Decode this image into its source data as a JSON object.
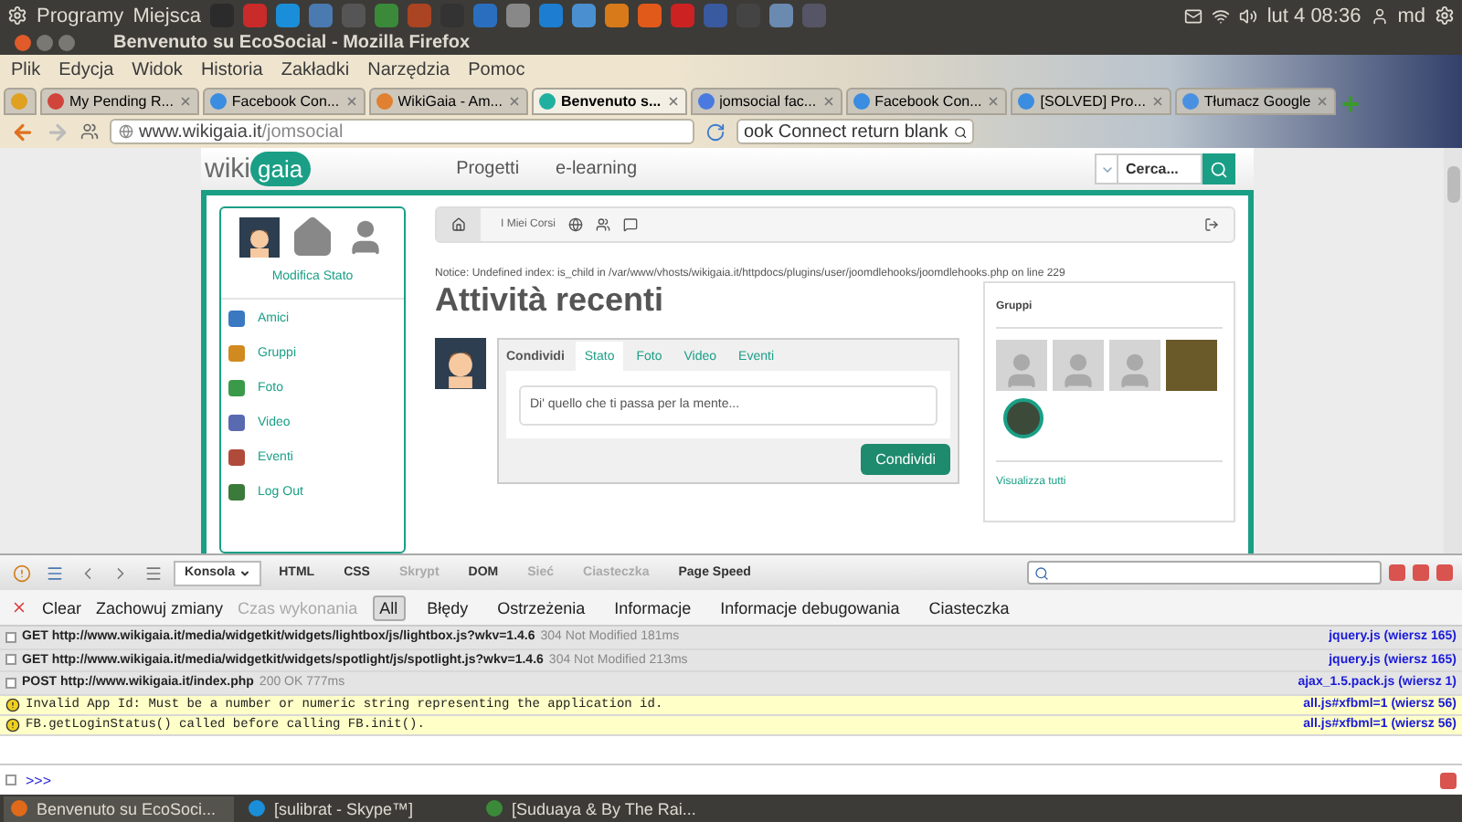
{
  "top_panel": {
    "menus": [
      "Programy",
      "Miejsca"
    ],
    "clock": "lut  4 08:36",
    "user": "md"
  },
  "window": {
    "title": "Benvenuto su EcoSocial - Mozilla Firefox"
  },
  "menu_bar": [
    "Plik",
    "Edycja",
    "Widok",
    "Historia",
    "Zakładki",
    "Narzędzia",
    "Pomoc"
  ],
  "tabs": [
    {
      "label": "My Pending R...",
      "selected": false
    },
    {
      "label": "Facebook Con...",
      "selected": false
    },
    {
      "label": "WikiGaia - Am...",
      "selected": false
    },
    {
      "label": "Benvenuto s...",
      "selected": true
    },
    {
      "label": "jomsocial fac...",
      "selected": false
    },
    {
      "label": "Facebook Con...",
      "selected": false
    },
    {
      "label": "[SOLVED] Pro...",
      "selected": false
    },
    {
      "label": "Tłumacz Google",
      "selected": false
    }
  ],
  "nav": {
    "url_domain": "www.wikigaia.it",
    "url_path": "/jomsocial",
    "search": "ook Connect return blank"
  },
  "site": {
    "logo_left": "wiki",
    "logo_right": "gaia",
    "links": [
      "Progetti",
      "e-learning"
    ],
    "search_placeholder": "Cerca..."
  },
  "sidebar": {
    "status_link": "Modifica Stato",
    "items": [
      "Amici",
      "Gruppi",
      "Foto",
      "Video",
      "Eventi",
      "Log Out"
    ]
  },
  "toolbar": {
    "label": "I Miei Corsi"
  },
  "notice": "Notice: Undefined index: is_child in /var/www/vhosts/wikigaia.it/httpdocs/plugins/user/joomdlehooks/joomdlehooks.php on line 229",
  "heading": "Attività recenti",
  "composer": {
    "label": "Condividi",
    "tabs": [
      {
        "label": "Stato",
        "selected": true
      },
      {
        "label": "Foto",
        "selected": false
      },
      {
        "label": "Video",
        "selected": false
      },
      {
        "label": "Eventi",
        "selected": false
      }
    ],
    "placeholder": "Di' quello che ti passa per la mente...",
    "button": "Condividi"
  },
  "groups": {
    "title": "Gruppi",
    "link": "Visualizza tutti"
  },
  "firebug": {
    "panels": [
      {
        "label": "Konsola",
        "selected": true,
        "disabled": false
      },
      {
        "label": "HTML",
        "selected": false,
        "disabled": false
      },
      {
        "label": "CSS",
        "selected": false,
        "disabled": false
      },
      {
        "label": "Skrypt",
        "selected": false,
        "disabled": true
      },
      {
        "label": "DOM",
        "selected": false,
        "disabled": false
      },
      {
        "label": "Sieć",
        "selected": false,
        "disabled": true
      },
      {
        "label": "Ciasteczka",
        "selected": false,
        "disabled": true
      },
      {
        "label": "Page Speed",
        "selected": false,
        "disabled": false
      }
    ],
    "actions": [
      {
        "label": "Clear",
        "disabled": false
      },
      {
        "label": "Zachowuj zmiany",
        "disabled": false
      },
      {
        "label": "Czas wykonania",
        "disabled": true
      }
    ],
    "filters": [
      {
        "label": "All",
        "selected": true
      },
      {
        "label": "Błędy",
        "selected": false
      },
      {
        "label": "Ostrzeżenia",
        "selected": false
      },
      {
        "label": "Informacje",
        "selected": false
      },
      {
        "label": "Informacje debugowania",
        "selected": false
      },
      {
        "label": "Ciasteczka",
        "selected": false
      }
    ],
    "log": [
      {
        "kind": "request",
        "text": "GET http://www.wikigaia.it/media/widgetkit/widgets/lightbox/js/lightbox.js?wkv=1.4.6",
        "status": "304 Not Modified 181ms",
        "source": "jquery.js (wiersz 165)"
      },
      {
        "kind": "request",
        "text": "GET http://www.wikigaia.it/media/widgetkit/widgets/spotlight/js/spotlight.js?wkv=1.4.6",
        "status": "304 Not Modified 213ms",
        "source": "jquery.js (wiersz 165)"
      },
      {
        "kind": "request",
        "text": "POST http://www.wikigaia.it/index.php",
        "status": "200 OK 777ms",
        "source": "ajax_1.5.pack.js (wiersz 1)"
      },
      {
        "kind": "warning",
        "text": "Invalid App Id: Must be a number or numeric string representing the application id.",
        "source": "all.js#xfbml=1 (wiersz 56)"
      },
      {
        "kind": "warning",
        "text": "FB.getLoginStatus() called before calling FB.init().",
        "source": "all.js#xfbml=1 (wiersz 56)"
      }
    ],
    "prompt": ">>>"
  },
  "taskbar": [
    "Benvenuto su EcoSoci...",
    "[sulibrat - Skype™]",
    "[Suduaya & By The Rai..."
  ]
}
